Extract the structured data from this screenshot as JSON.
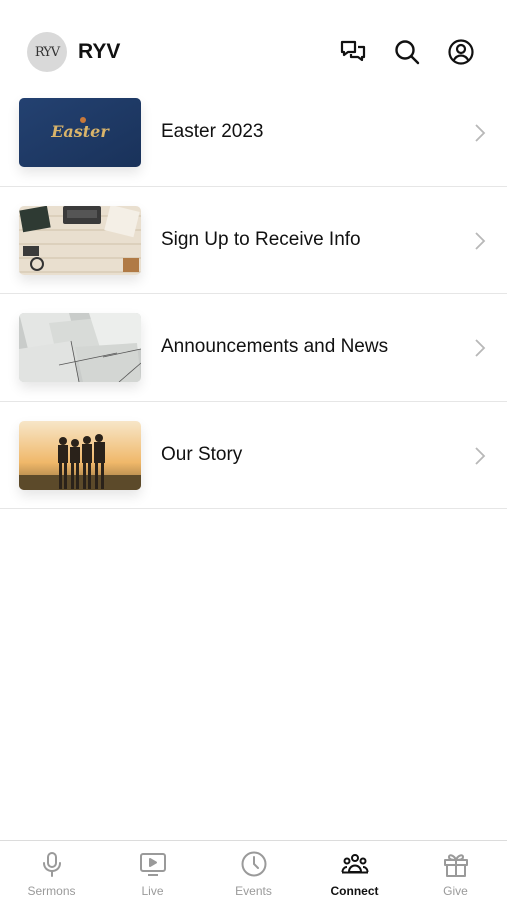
{
  "header": {
    "logo_text": "RYV",
    "brand": "RYV",
    "icons": [
      "chat-bubbles-icon",
      "search-icon",
      "account-icon"
    ]
  },
  "list": {
    "items": [
      {
        "label": "Easter 2023",
        "thumbnail": "easter-banner",
        "thumb_text": "Easter"
      },
      {
        "label": "Sign Up to Receive Info",
        "thumbnail": "desk-typewriter"
      },
      {
        "label": "Announcements and News",
        "thumbnail": "scattered-papers"
      },
      {
        "label": "Our Story",
        "thumbnail": "friends-sunset"
      }
    ]
  },
  "tabbar": {
    "tabs": [
      {
        "label": "Sermons",
        "icon": "microphone-icon",
        "active": false
      },
      {
        "label": "Live",
        "icon": "tv-play-icon",
        "active": false
      },
      {
        "label": "Events",
        "icon": "clock-icon",
        "active": false
      },
      {
        "label": "Connect",
        "icon": "people-group-icon",
        "active": true
      },
      {
        "label": "Give",
        "icon": "gift-icon",
        "active": false
      }
    ]
  },
  "colors": {
    "text": "#111111",
    "inactive_tab": "#9a9a9a",
    "divider": "#e6e6e6",
    "easter_blue": "#1f3a66",
    "easter_gold": "#d9b46a"
  }
}
